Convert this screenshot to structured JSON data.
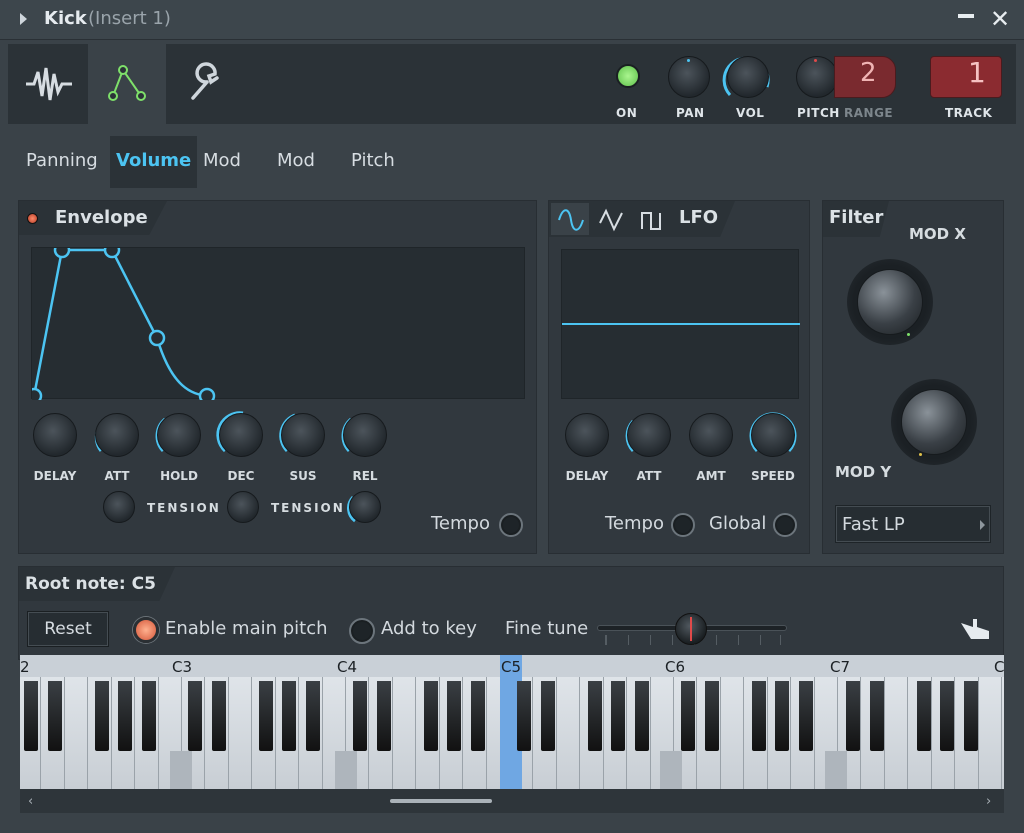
{
  "window": {
    "title": "Kick",
    "subtitle": "(Insert 1)"
  },
  "toolbar": {
    "on_label": "ON",
    "pan_label": "PAN",
    "vol_label": "VOL",
    "pitch_label": "PITCH",
    "range_label": "RANGE",
    "range_value": "2",
    "track_label": "TRACK",
    "track_value": "1",
    "icons": [
      "waveform-icon",
      "envelope-icon",
      "wrench-icon"
    ]
  },
  "tabs": [
    "Panning",
    "Volume",
    "Mod X",
    "Mod Y",
    "Pitch"
  ],
  "selected_tab": "Volume",
  "envelope": {
    "title": "Envelope",
    "knobs": [
      "DELAY",
      "ATT",
      "HOLD",
      "DEC",
      "SUS",
      "REL"
    ],
    "tension_label": "TENSION",
    "tempo_label": "Tempo"
  },
  "lfo": {
    "title": "LFO",
    "knobs": [
      "DELAY",
      "ATT",
      "AMT",
      "SPEED"
    ],
    "tempo_label": "Tempo",
    "global_label": "Global"
  },
  "filter": {
    "title": "Filter",
    "modx_label": "MOD X",
    "mody_label": "MOD Y",
    "type": "Fast LP"
  },
  "root": {
    "title": "Root note: C5",
    "reset_label": "Reset",
    "enable_main_pitch_label": "Enable main pitch",
    "add_to_key_label": "Add to key",
    "fine_tune_label": "Fine tune"
  },
  "keyboard": {
    "octave_labels": [
      "2",
      "C3",
      "C4",
      "C5",
      "C6",
      "C7",
      "C"
    ],
    "selected_note": "C5"
  },
  "colors": {
    "accent": "#4cc4f2",
    "led_on": "#7ee06a",
    "track_red": "#8b2b30"
  }
}
